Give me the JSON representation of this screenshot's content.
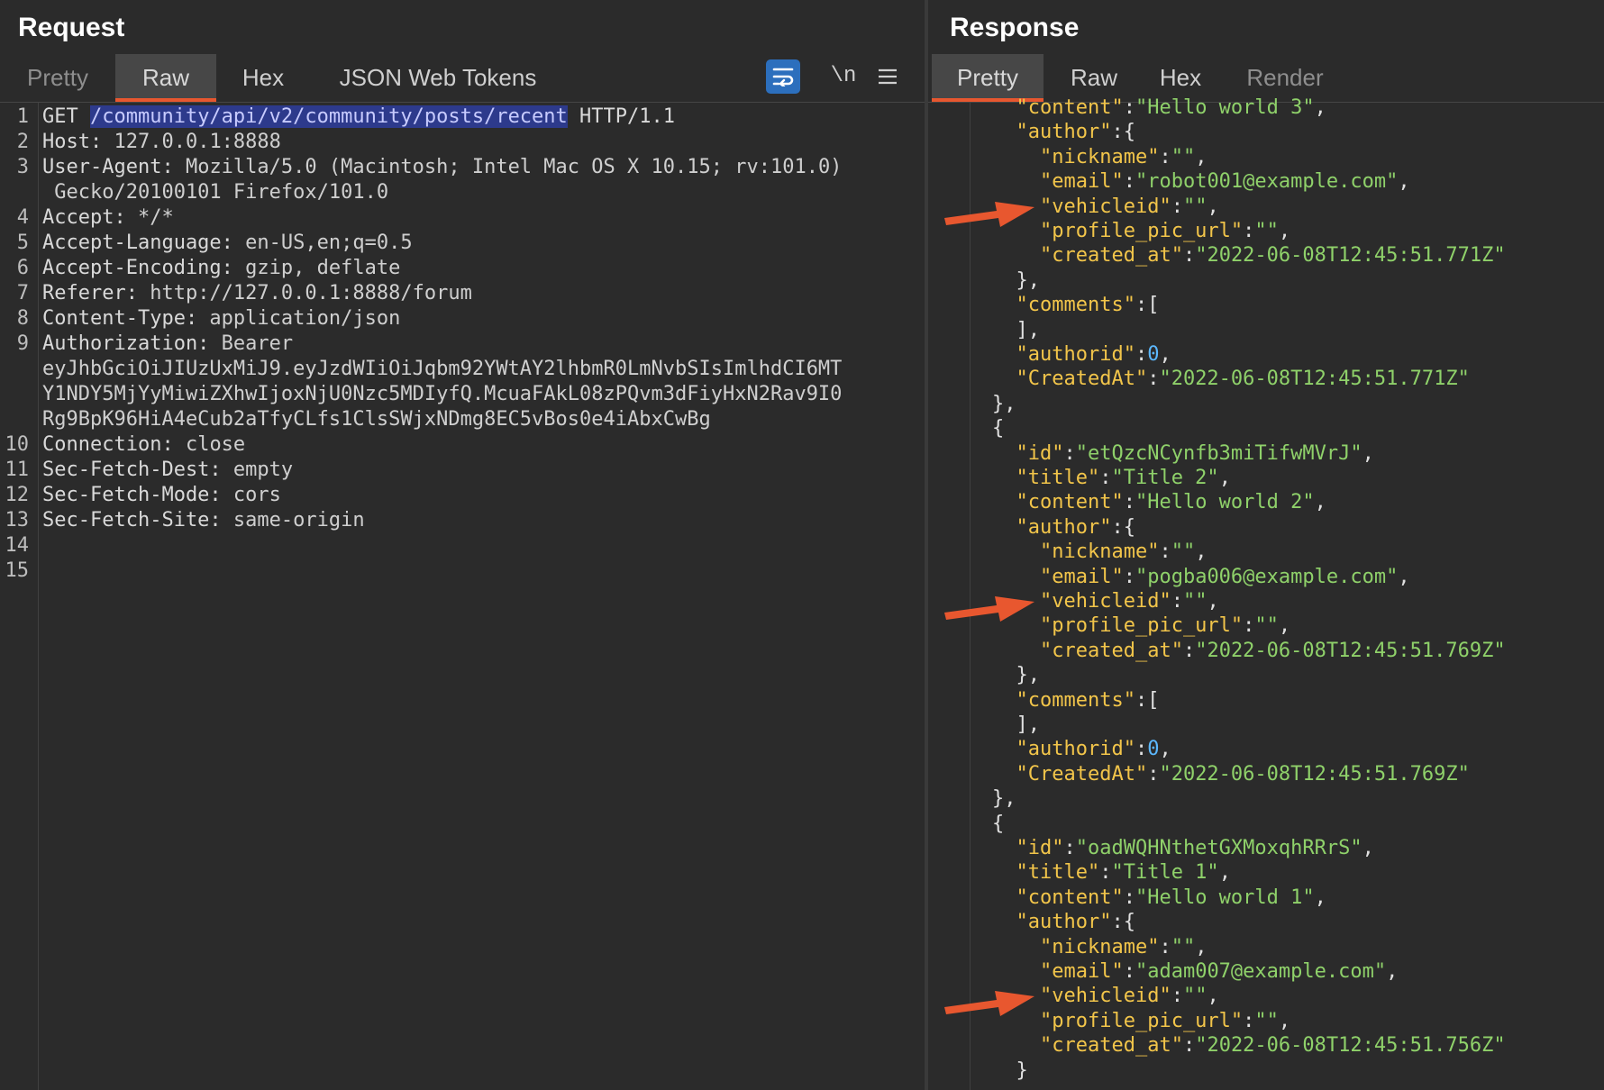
{
  "request": {
    "title": "Request",
    "tabs": [
      "Pretty",
      "Raw",
      "Hex",
      "JSON Web Tokens"
    ],
    "active_tab": "Raw",
    "tools": {
      "newline_label": "\\n",
      "wrap_icon": "wrap-lines-icon",
      "menu_icon": "hamburger-menu-icon"
    },
    "lines": [
      {
        "n": "1",
        "method": "GET ",
        "path": "/community/api/v2/community/posts/recent",
        "proto": " HTTP/1.1"
      },
      {
        "n": "2",
        "name": "Host:",
        "value": " 127.0.0.1:8888"
      },
      {
        "n": "3",
        "name": "User-Agent:",
        "value": " Mozilla/5.0 (Macintosh; Intel Mac OS X 10.15; rv:101.0)"
      },
      {
        "n": "",
        "value": " Gecko/20100101 Firefox/101.0"
      },
      {
        "n": "4",
        "name": "Accept:",
        "value": " */*"
      },
      {
        "n": "5",
        "name": "Accept-Language:",
        "value": " en-US,en;q=0.5"
      },
      {
        "n": "6",
        "name": "Accept-Encoding:",
        "value": " gzip, deflate"
      },
      {
        "n": "7",
        "name": "Referer:",
        "value": " http://127.0.0.1:8888/forum"
      },
      {
        "n": "8",
        "name": "Content-Type:",
        "value": " application/json"
      },
      {
        "n": "9",
        "name": "Authorization:",
        "value": " Bearer"
      },
      {
        "n": "",
        "value": "eyJhbGciOiJIUzUxMiJ9.eyJzdWIiOiJqbm92YWtAY2lhbmR0LmNvbSIsImlhdCI6MT"
      },
      {
        "n": "",
        "value": "Y1NDY5MjYyMiwiZXhwIjoxNjU0Nzc5MDIyfQ.McuaFAkL08zPQvm3dFiyHxN2Rav9I0"
      },
      {
        "n": "",
        "value": "Rg9BpK96HiA4eCub2aTfyCLfs1ClsSWjxNDmg8EC5vBos0e4iAbxCwBg"
      },
      {
        "n": "10",
        "name": "Connection:",
        "value": " close"
      },
      {
        "n": "11",
        "name": "Sec-Fetch-Dest:",
        "value": " empty"
      },
      {
        "n": "12",
        "name": "Sec-Fetch-Mode:",
        "value": " cors"
      },
      {
        "n": "13",
        "name": "Sec-Fetch-Site:",
        "value": " same-origin"
      },
      {
        "n": "14"
      },
      {
        "n": "15"
      }
    ]
  },
  "response": {
    "title": "Response",
    "tabs": [
      "Pretty",
      "Raw",
      "Hex",
      "Render"
    ],
    "active_tab": "Pretty",
    "arrow_color": "#e8572f",
    "lines": [
      {
        "indent": 3,
        "k": "\"content\"",
        "colon": ":",
        "s": "\"Hello world 3\"",
        "tail": ","
      },
      {
        "indent": 3,
        "k": "\"author\"",
        "colon": ":",
        "tail": "{"
      },
      {
        "indent": 4,
        "k": "\"nickname\"",
        "colon": ":",
        "s": "\"\"",
        "tail": ","
      },
      {
        "indent": 4,
        "k": "\"email\"",
        "colon": ":",
        "s": "\"robot001@example.com\"",
        "tail": ","
      },
      {
        "indent": 4,
        "k": "\"vehicleid\"",
        "colon": ":",
        "s": "\"\"",
        "tail": ",",
        "arrow": true
      },
      {
        "indent": 4,
        "k": "\"profile_pic_url\"",
        "colon": ":",
        "s": "\"\"",
        "tail": ","
      },
      {
        "indent": 4,
        "k": "\"created_at\"",
        "colon": ":",
        "s": "\"2022-06-08T12:45:51.771Z\""
      },
      {
        "indent": 3,
        "tail": "},"
      },
      {
        "indent": 3,
        "k": "\"comments\"",
        "colon": ":",
        "tail": "["
      },
      {
        "indent": 3,
        "tail": "],"
      },
      {
        "indent": 3,
        "k": "\"authorid\"",
        "colon": ":",
        "num": "0",
        "tail": ","
      },
      {
        "indent": 3,
        "k": "\"CreatedAt\"",
        "colon": ":",
        "s": "\"2022-06-08T12:45:51.771Z\""
      },
      {
        "indent": 2,
        "tail": "},"
      },
      {
        "indent": 2,
        "tail": "{"
      },
      {
        "indent": 3,
        "k": "\"id\"",
        "colon": ":",
        "s": "\"etQzcNCynfb3miTifwMVrJ\"",
        "tail": ","
      },
      {
        "indent": 3,
        "k": "\"title\"",
        "colon": ":",
        "s": "\"Title 2\"",
        "tail": ","
      },
      {
        "indent": 3,
        "k": "\"content\"",
        "colon": ":",
        "s": "\"Hello world 2\"",
        "tail": ","
      },
      {
        "indent": 3,
        "k": "\"author\"",
        "colon": ":",
        "tail": "{"
      },
      {
        "indent": 4,
        "k": "\"nickname\"",
        "colon": ":",
        "s": "\"\"",
        "tail": ","
      },
      {
        "indent": 4,
        "k": "\"email\"",
        "colon": ":",
        "s": "\"pogba006@example.com\"",
        "tail": ","
      },
      {
        "indent": 4,
        "k": "\"vehicleid\"",
        "colon": ":",
        "s": "\"\"",
        "tail": ",",
        "arrow": true
      },
      {
        "indent": 4,
        "k": "\"profile_pic_url\"",
        "colon": ":",
        "s": "\"\"",
        "tail": ","
      },
      {
        "indent": 4,
        "k": "\"created_at\"",
        "colon": ":",
        "s": "\"2022-06-08T12:45:51.769Z\""
      },
      {
        "indent": 3,
        "tail": "},"
      },
      {
        "indent": 3,
        "k": "\"comments\"",
        "colon": ":",
        "tail": "["
      },
      {
        "indent": 3,
        "tail": "],"
      },
      {
        "indent": 3,
        "k": "\"authorid\"",
        "colon": ":",
        "num": "0",
        "tail": ","
      },
      {
        "indent": 3,
        "k": "\"CreatedAt\"",
        "colon": ":",
        "s": "\"2022-06-08T12:45:51.769Z\""
      },
      {
        "indent": 2,
        "tail": "},"
      },
      {
        "indent": 2,
        "tail": "{"
      },
      {
        "indent": 3,
        "k": "\"id\"",
        "colon": ":",
        "s": "\"oadWQHNthetGXMoxqhRRrS\"",
        "tail": ","
      },
      {
        "indent": 3,
        "k": "\"title\"",
        "colon": ":",
        "s": "\"Title 1\"",
        "tail": ","
      },
      {
        "indent": 3,
        "k": "\"content\"",
        "colon": ":",
        "s": "\"Hello world 1\"",
        "tail": ","
      },
      {
        "indent": 3,
        "k": "\"author\"",
        "colon": ":",
        "tail": "{"
      },
      {
        "indent": 4,
        "k": "\"nickname\"",
        "colon": ":",
        "s": "\"\"",
        "tail": ","
      },
      {
        "indent": 4,
        "k": "\"email\"",
        "colon": ":",
        "s": "\"adam007@example.com\"",
        "tail": ","
      },
      {
        "indent": 4,
        "k": "\"vehicleid\"",
        "colon": ":",
        "s": "\"\"",
        "tail": ",",
        "arrow": true
      },
      {
        "indent": 4,
        "k": "\"profile_pic_url\"",
        "colon": ":",
        "s": "\"\"",
        "tail": ","
      },
      {
        "indent": 4,
        "k": "\"created_at\"",
        "colon": ":",
        "s": "\"2022-06-08T12:45:51.756Z\""
      },
      {
        "indent": 3,
        "tail": "}"
      }
    ]
  }
}
